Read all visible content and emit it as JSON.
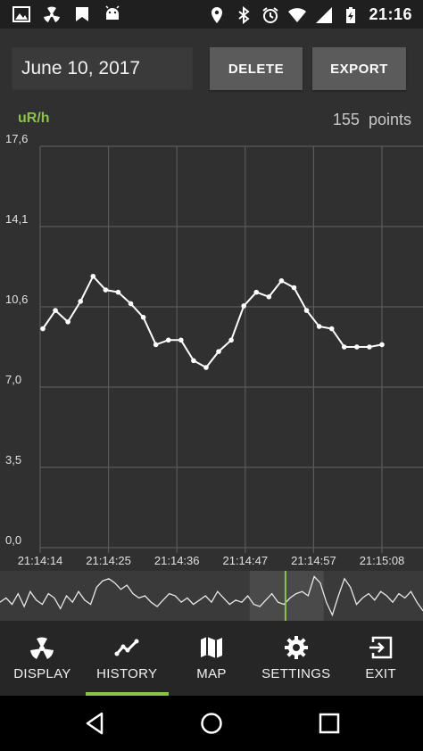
{
  "status_bar": {
    "time": "21:16",
    "left_icons": [
      "image-icon",
      "radiation-icon",
      "bookmark-icon",
      "android-icon"
    ],
    "right_icons": [
      "location-icon",
      "bluetooth-icon",
      "alarm-icon",
      "wifi-icon",
      "signal-icon",
      "battery-icon"
    ]
  },
  "toolbar": {
    "date": "June 10, 2017",
    "delete_label": "DELETE",
    "export_label": "EXPORT"
  },
  "header": {
    "unit": "uR/h",
    "points_count": "155",
    "points_label": "points"
  },
  "colors": {
    "accent": "#8bc34a",
    "background": "#303030",
    "grid": "#5a5a5a",
    "line": "#ffffff"
  },
  "chart_data": {
    "type": "line",
    "y_ticks": [
      "0,0",
      "3,5",
      "7,0",
      "10,6",
      "14,1",
      "17,6"
    ],
    "x_ticks": [
      "21:14:14",
      "21:14:25",
      "21:14:36",
      "21:14:47",
      "21:14:57",
      "21:15:08"
    ],
    "ylim": [
      0,
      17.6
    ],
    "grid": true,
    "series": [
      {
        "values": [
          9.6,
          10.4,
          9.9,
          10.8,
          11.9,
          11.3,
          11.2,
          10.7,
          10.1,
          8.9,
          9.1,
          9.1,
          8.2,
          7.9,
          8.6,
          9.1,
          10.6,
          11.2,
          11.0,
          11.7,
          11.4,
          10.4,
          9.7,
          9.6,
          8.8,
          8.8,
          8.8,
          8.9
        ]
      }
    ]
  },
  "overview": {
    "values": [
      0.35,
      0.45,
      0.3,
      0.55,
      0.25,
      0.6,
      0.4,
      0.3,
      0.55,
      0.45,
      0.2,
      0.5,
      0.35,
      0.6,
      0.4,
      0.3,
      0.7,
      0.85,
      0.9,
      0.8,
      0.65,
      0.75,
      0.55,
      0.45,
      0.5,
      0.35,
      0.25,
      0.4,
      0.55,
      0.5,
      0.35,
      0.45,
      0.3,
      0.4,
      0.5,
      0.35,
      0.6,
      0.45,
      0.3,
      0.4,
      0.35,
      0.5,
      0.3,
      0.25,
      0.4,
      0.55,
      0.35,
      0.3,
      0.45,
      0.55,
      0.6,
      0.5,
      0.95,
      0.8,
      0.35,
      0.05,
      0.5,
      0.9,
      0.7,
      0.3,
      0.45,
      0.55,
      0.4,
      0.6,
      0.5,
      0.35,
      0.55,
      0.45,
      0.6,
      0.35,
      0.15
    ],
    "window_start": 0.59,
    "window_end": 0.765,
    "cursor": 0.675
  },
  "nav_tabs": [
    {
      "label": "DISPLAY",
      "icon": "radiation-icon",
      "active": false
    },
    {
      "label": "HISTORY",
      "icon": "chart-line-icon",
      "active": true
    },
    {
      "label": "MAP",
      "icon": "map-icon",
      "active": false
    },
    {
      "label": "SETTINGS",
      "icon": "gear-icon",
      "active": false
    },
    {
      "label": "EXIT",
      "icon": "exit-icon",
      "active": false
    }
  ],
  "system_nav": [
    "back-icon",
    "home-icon",
    "recents-icon"
  ]
}
